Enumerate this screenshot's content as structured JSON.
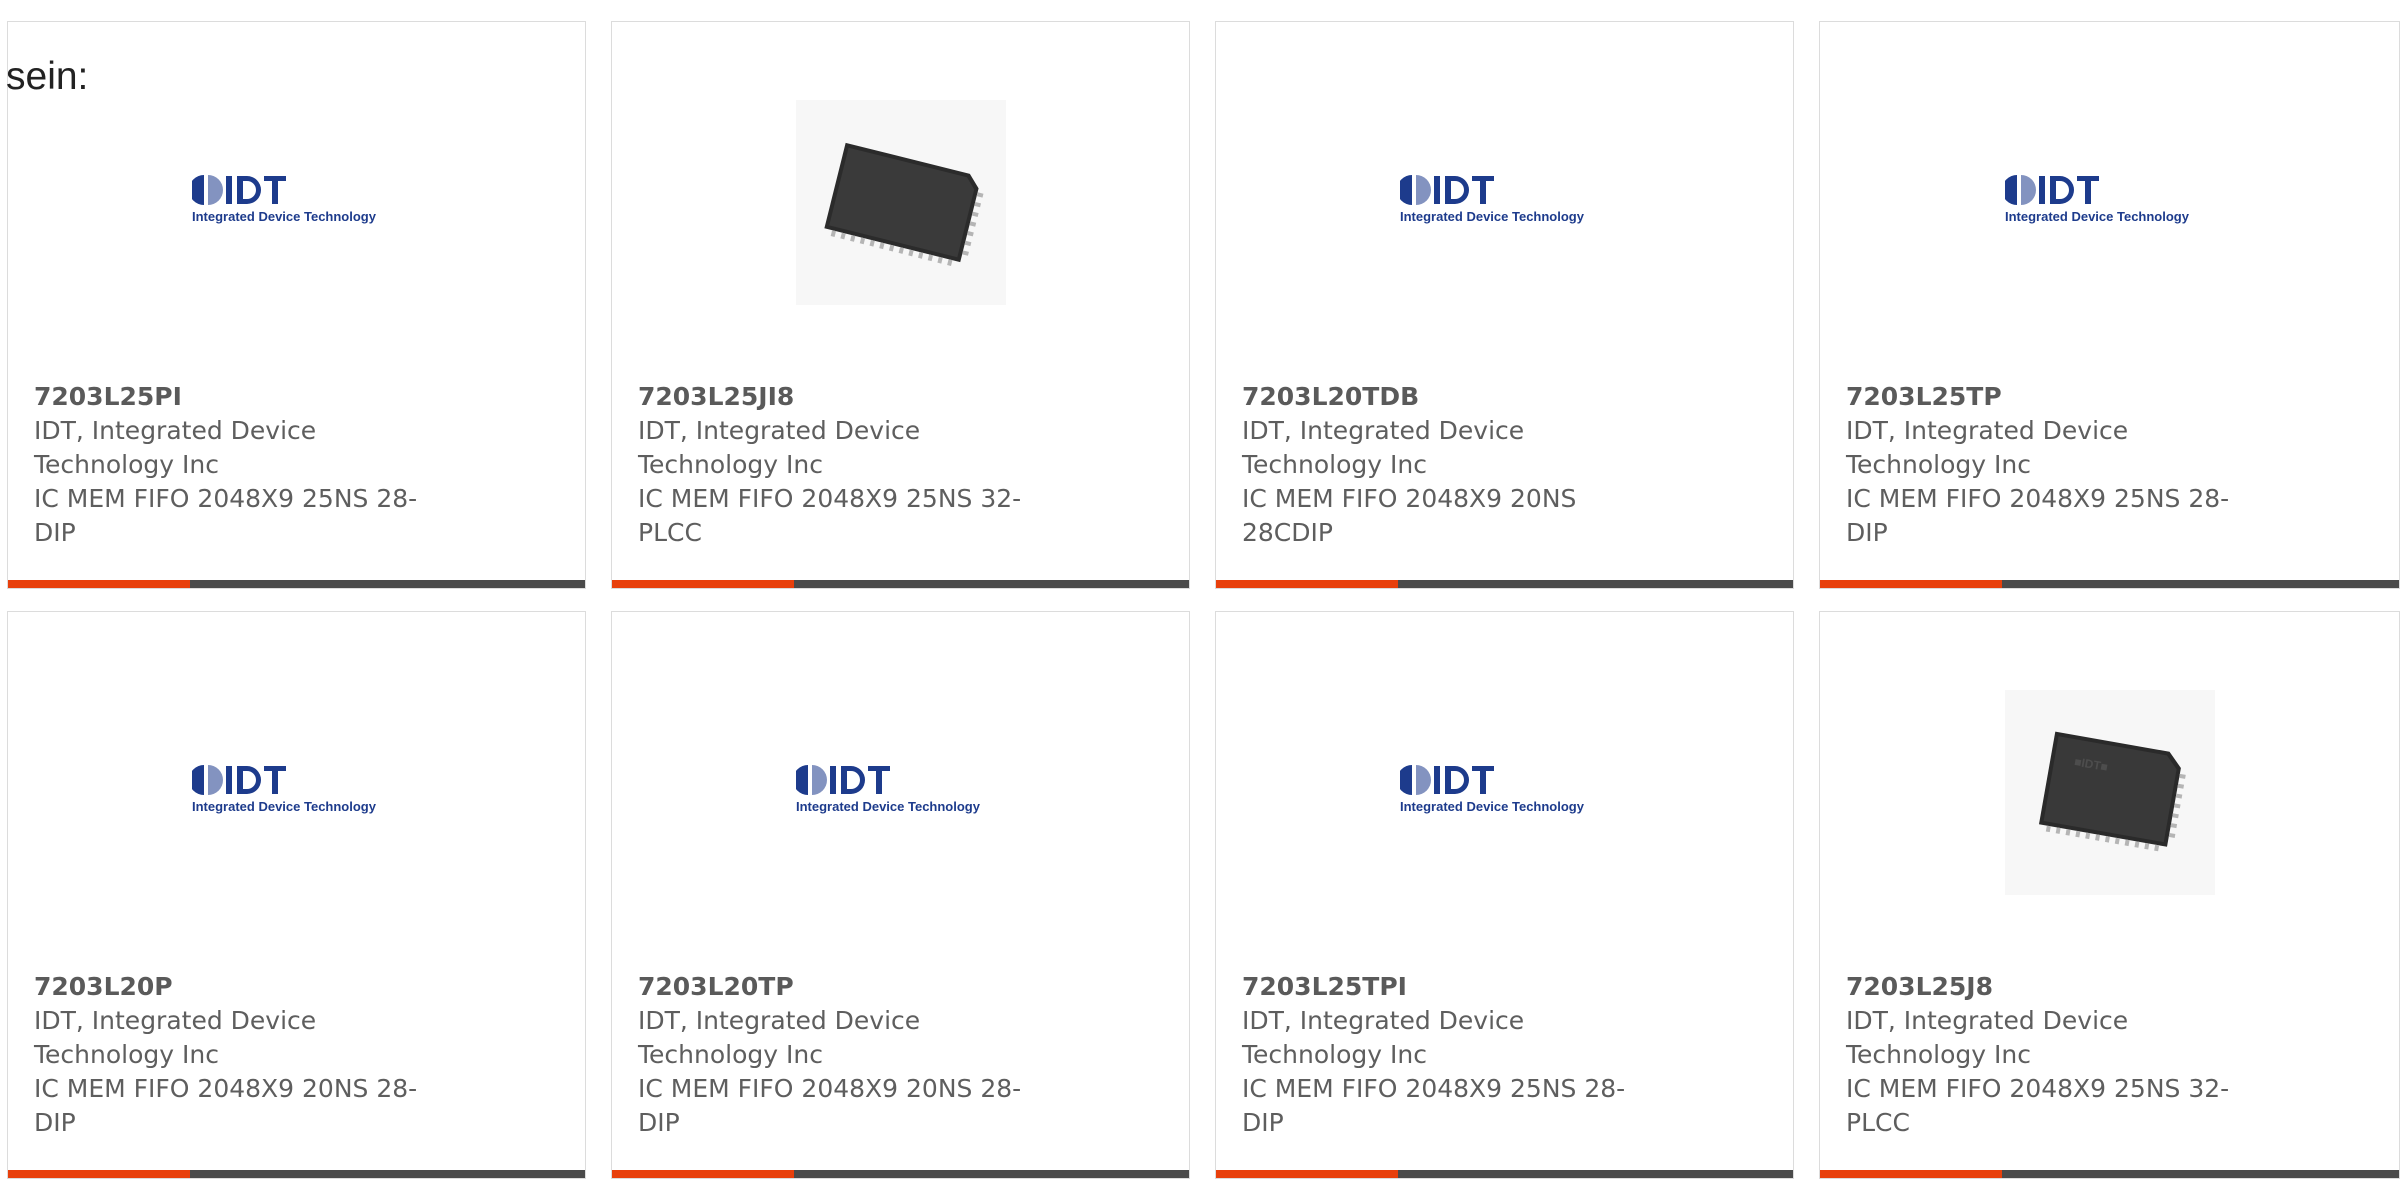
{
  "intro_text": "sein:",
  "colors": {
    "accent": "#e8400c",
    "bar": "#4a4a4a",
    "idt_blue": "#1d3b8c"
  },
  "products": [
    {
      "part_number": "7203L25PI",
      "manufacturer": "IDT, Integrated Device Technology Inc",
      "description": "IC MEM FIFO 2048X9 25NS 28-DIP",
      "image": "idt-logo",
      "logo_text": "IDT",
      "logo_subtitle": "Integrated Device Technology"
    },
    {
      "part_number": "7203L25JI8",
      "manufacturer": "IDT, Integrated Device Technology Inc",
      "description": "IC MEM FIFO 2048X9 25NS 32-PLCC",
      "image": "plcc-chip"
    },
    {
      "part_number": "7203L20TDB",
      "manufacturer": "IDT, Integrated Device Technology Inc",
      "description": "IC MEM FIFO 2048X9 20NS 28CDIP",
      "image": "idt-logo",
      "logo_text": "IDT",
      "logo_subtitle": "Integrated Device Technology"
    },
    {
      "part_number": "7203L25TP",
      "manufacturer": "IDT, Integrated Device Technology Inc",
      "description": "IC MEM FIFO 2048X9 25NS 28-DIP",
      "image": "idt-logo",
      "logo_text": "IDT",
      "logo_subtitle": "Integrated Device Technology"
    },
    {
      "part_number": "7203L20P",
      "manufacturer": "IDT, Integrated Device Technology Inc",
      "description": "IC MEM FIFO 2048X9 20NS 28-DIP",
      "image": "idt-logo",
      "logo_text": "IDT",
      "logo_subtitle": "Integrated Device Technology"
    },
    {
      "part_number": "7203L20TP",
      "manufacturer": "IDT, Integrated Device Technology Inc",
      "description": "IC MEM FIFO 2048X9 20NS 28-DIP",
      "image": "idt-logo",
      "logo_text": "IDT",
      "logo_subtitle": "Integrated Device Technology"
    },
    {
      "part_number": "7203L25TPI",
      "manufacturer": "IDT, Integrated Device Technology Inc",
      "description": "IC MEM FIFO 2048X9 25NS 28-DIP",
      "image": "idt-logo",
      "logo_text": "IDT",
      "logo_subtitle": "Integrated Device Technology"
    },
    {
      "part_number": "7203L25J8",
      "manufacturer": "IDT, Integrated Device Technology Inc",
      "description": "IC MEM FIFO 2048X9 25NS 32-PLCC",
      "image": "plcc-chip-branded"
    }
  ]
}
